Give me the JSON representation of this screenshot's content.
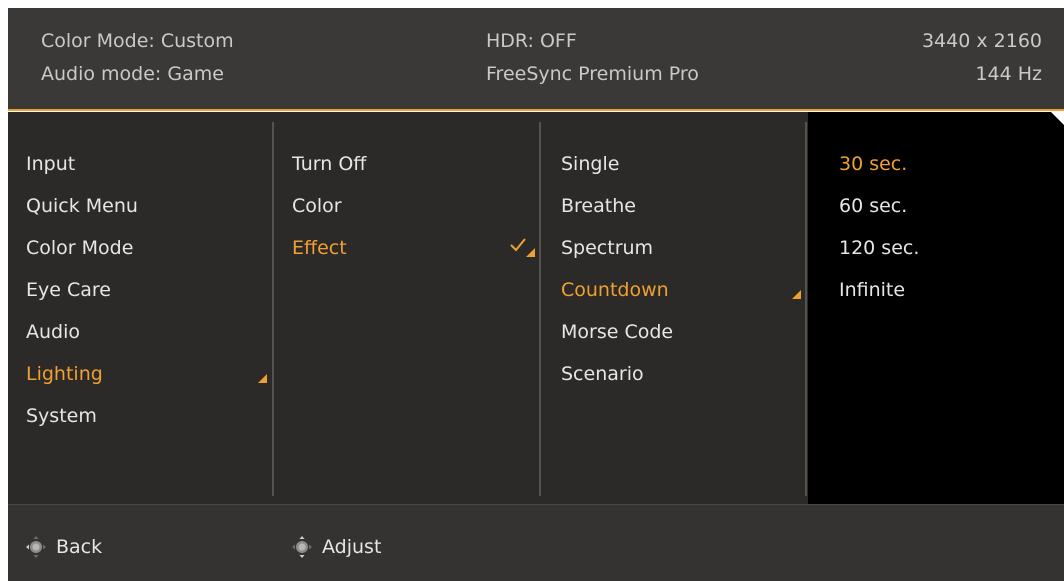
{
  "header": {
    "color_mode": "Color Mode: Custom",
    "audio_mode": "Audio mode: Game",
    "hdr": "HDR: OFF",
    "freesync": "FreeSync Premium Pro",
    "resolution": "3440 x 2160",
    "refresh": "144 Hz"
  },
  "menu": {
    "items": [
      {
        "label": "Input"
      },
      {
        "label": "Quick Menu"
      },
      {
        "label": "Color Mode"
      },
      {
        "label": "Eye Care"
      },
      {
        "label": "Audio"
      },
      {
        "label": "Lighting",
        "selected": true
      },
      {
        "label": "System"
      }
    ]
  },
  "lighting": {
    "items": [
      {
        "label": "Turn Off"
      },
      {
        "label": "Color"
      },
      {
        "label": "Effect",
        "selected": true,
        "checked": true
      }
    ]
  },
  "effect": {
    "items": [
      {
        "label": "Single"
      },
      {
        "label": "Breathe"
      },
      {
        "label": "Spectrum"
      },
      {
        "label": "Countdown",
        "selected": true
      },
      {
        "label": "Morse Code"
      },
      {
        "label": "Scenario"
      }
    ]
  },
  "countdown": {
    "items": [
      {
        "label": "30 sec.",
        "selected": true
      },
      {
        "label": "60 sec."
      },
      {
        "label": "120 sec."
      },
      {
        "label": "Infinite"
      }
    ]
  },
  "footer": {
    "back_label": "Back",
    "adjust_label": "Adjust"
  },
  "colors": {
    "accent": "#f0a030",
    "header_bg": "#3b3937",
    "menu_bg": "#2b2a28",
    "column4_bg": "#000000",
    "footer_bg": "#353331",
    "text": "#e6e6e6"
  },
  "icons": {
    "joystick_left_right": "joystick-left-right-icon",
    "joystick_up_down": "joystick-up-down-icon",
    "check": "check-icon",
    "submenu_arrow": "submenu-arrow-icon"
  }
}
